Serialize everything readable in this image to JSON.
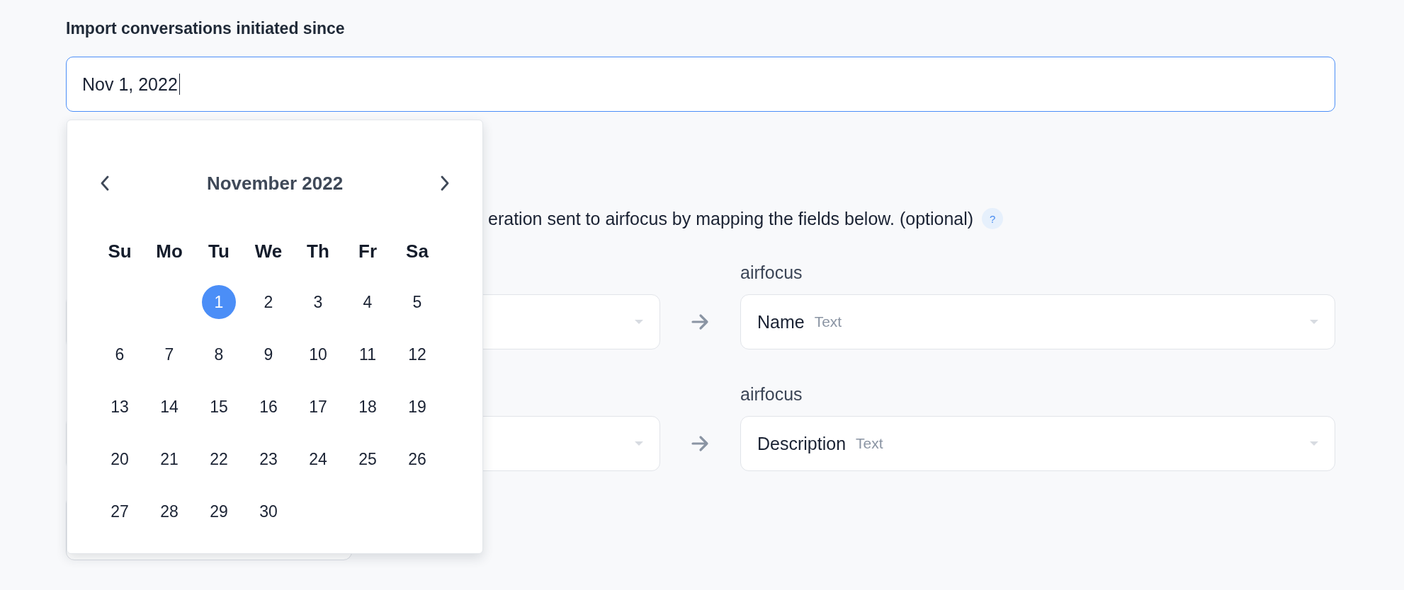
{
  "import_since": {
    "label": "Import conversations initiated since",
    "value": "Nov 1, 2022",
    "focused": true
  },
  "date_picker": {
    "month": "November 2022",
    "weekdays": [
      "Su",
      "Mo",
      "Tu",
      "We",
      "Th",
      "Fr",
      "Sa"
    ],
    "weeks": [
      [
        {
          "day": "1",
          "selected": true
        },
        {
          "day": "2",
          "selected": false
        },
        {
          "day": "3",
          "selected": false
        },
        {
          "day": "4",
          "selected": false
        },
        {
          "day": "5",
          "selected": false
        }
      ],
      [
        {
          "day": "6",
          "selected": false
        },
        {
          "day": "7",
          "selected": false
        },
        {
          "day": "8",
          "selected": false
        },
        {
          "day": "9",
          "selected": false
        },
        {
          "day": "10",
          "selected": false
        },
        {
          "day": "11",
          "selected": false
        },
        {
          "day": "12",
          "selected": false
        }
      ],
      [
        {
          "day": "13",
          "selected": false
        },
        {
          "day": "14",
          "selected": false
        },
        {
          "day": "15",
          "selected": false
        },
        {
          "day": "16",
          "selected": false
        },
        {
          "day": "17",
          "selected": false
        },
        {
          "day": "18",
          "selected": false
        },
        {
          "day": "19",
          "selected": false
        }
      ],
      [
        {
          "day": "20",
          "selected": false
        },
        {
          "day": "21",
          "selected": false
        },
        {
          "day": "22",
          "selected": false
        },
        {
          "day": "23",
          "selected": false
        },
        {
          "day": "24",
          "selected": false
        },
        {
          "day": "25",
          "selected": false
        },
        {
          "day": "26",
          "selected": false
        }
      ],
      [
        {
          "day": "27",
          "selected": false
        },
        {
          "day": "28",
          "selected": false
        },
        {
          "day": "29",
          "selected": false
        },
        {
          "day": "30",
          "selected": false
        }
      ]
    ]
  },
  "mapping": {
    "description": "eration sent to airfocus by mapping the fields below. (optional)",
    "help": "?",
    "rows": [
      {
        "target_label": "airfocus",
        "field": "Name",
        "type": "Text"
      },
      {
        "target_label": "airfocus",
        "field": "Description",
        "type": "Text"
      }
    ]
  }
}
